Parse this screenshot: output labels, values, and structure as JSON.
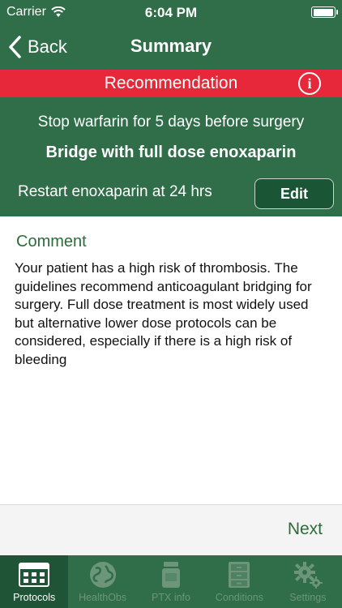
{
  "status_bar": {
    "carrier": "Carrier",
    "time": "6:04 PM"
  },
  "nav": {
    "back_label": "Back",
    "title": "Summary"
  },
  "recommendation": {
    "header": "Recommendation",
    "line1": "Stop warfarin for 5 days before surgery",
    "line2": "Bridge with full dose enoxaparin",
    "line3": "Restart enoxaparin at 24 hrs",
    "edit_label": "Edit"
  },
  "comment": {
    "heading": "Comment",
    "body": "Your patient has a high risk of thrombosis. The guidelines recommend anticoagulant bridging for surgery. Full dose treatment is most widely used but alternative lower dose protocols can be considered, especially if there is a high risk of bleeding"
  },
  "footer": {
    "next_label": "Next"
  },
  "tabs": [
    {
      "label": "Protocols",
      "icon": "protocols-icon",
      "active": true
    },
    {
      "label": "HealthObs",
      "icon": "globe-icon",
      "active": false
    },
    {
      "label": "PTX info",
      "icon": "pill-bottle-icon",
      "active": false
    },
    {
      "label": "Conditions",
      "icon": "cabinet-icon",
      "active": false
    },
    {
      "label": "Settings",
      "icon": "gear-icon",
      "active": false
    }
  ],
  "colors": {
    "primary_green": "#2f6e49",
    "alert_red": "#e6283a",
    "accent_text_green": "#2d6b3a"
  }
}
